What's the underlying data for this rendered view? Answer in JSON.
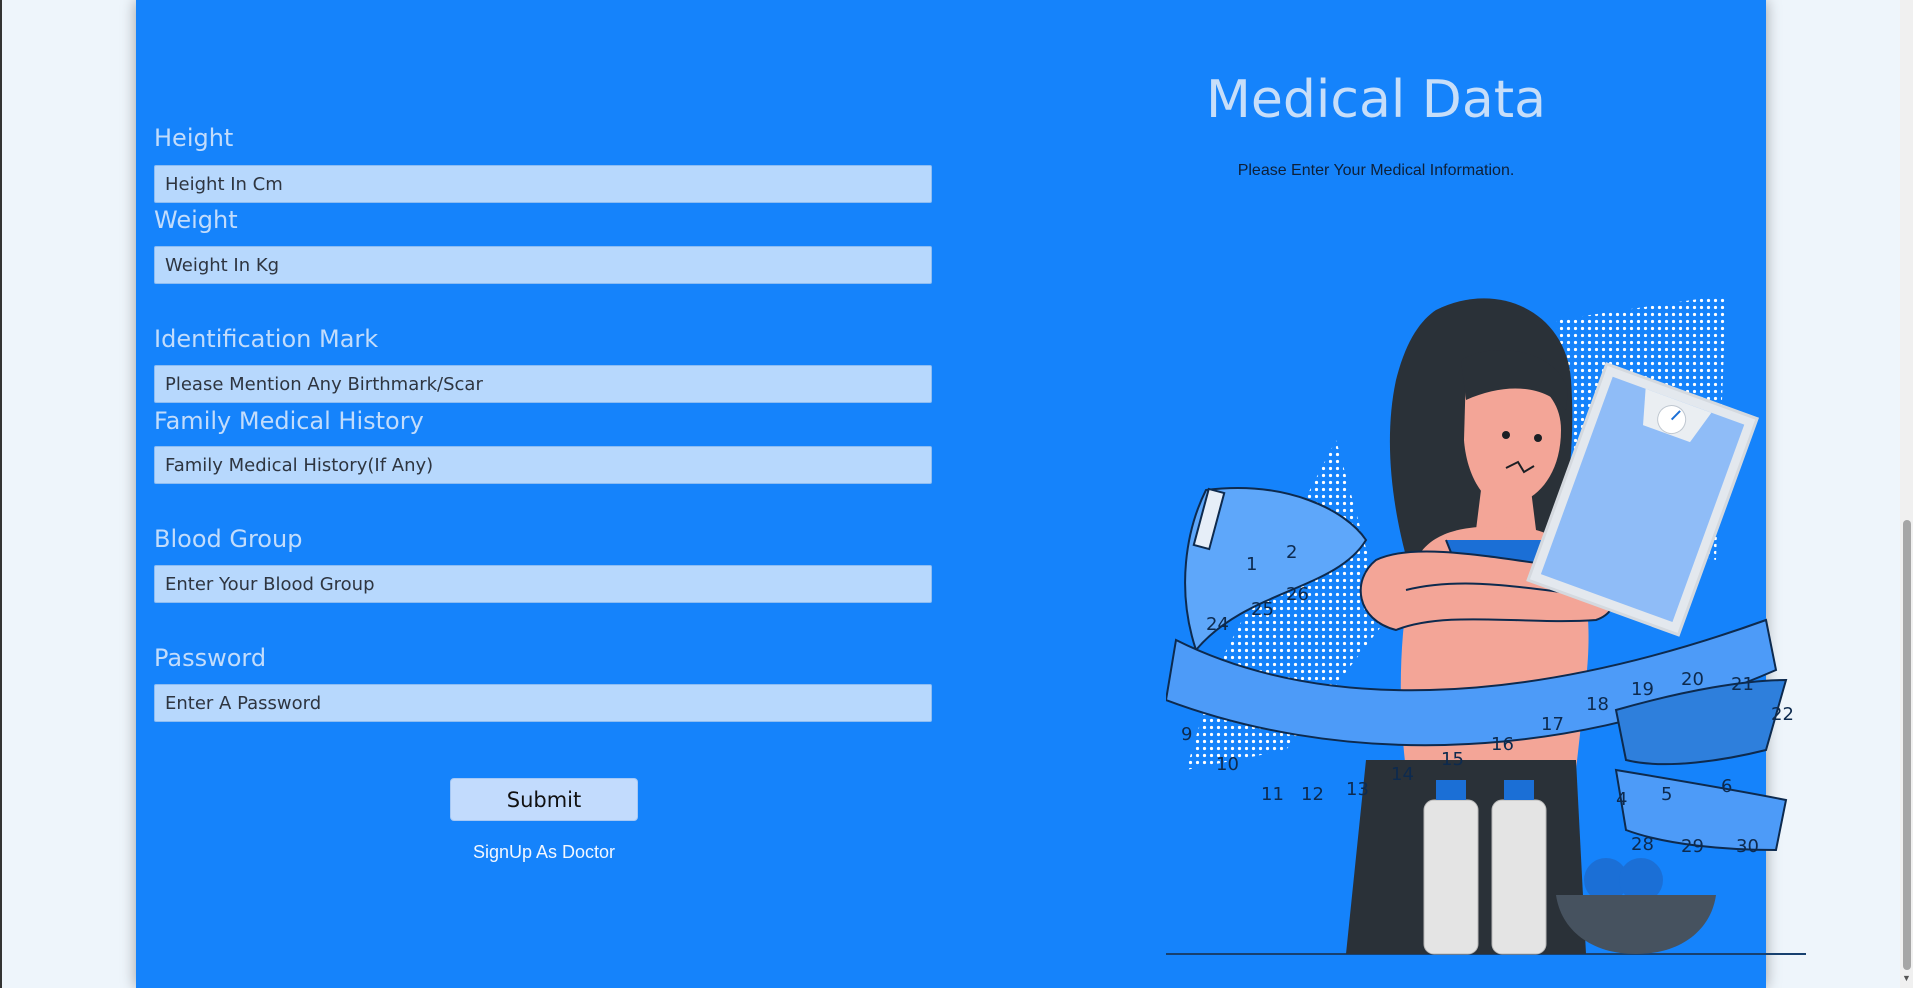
{
  "page": {
    "title": "Medical Data",
    "subtitle": "Please Enter Your Medical Information."
  },
  "form": {
    "fields": [
      {
        "label": "Height",
        "placeholder": "Height In Cm"
      },
      {
        "label": "Weight",
        "placeholder": "Weight In Kg"
      },
      {
        "label": "Identification Mark",
        "placeholder": "Please Mention Any Birthmark/Scar"
      },
      {
        "label": "Family Medical History",
        "placeholder": "Family Medical History(If Any)"
      },
      {
        "label": "Blood Group",
        "placeholder": "Enter Your Blood Group"
      },
      {
        "label": "Password",
        "placeholder": "Enter A Password"
      }
    ],
    "submit_label": "Submit",
    "signup_link": "SignUp As Doctor"
  },
  "illustration": {
    "icon": "woman-with-scale-and-measuring-tape-illustration",
    "scale_numbers": [
      "1",
      "2",
      "24",
      "25",
      "26",
      "9",
      "10",
      "11",
      "12",
      "13",
      "14",
      "15",
      "16",
      "17",
      "18",
      "19",
      "20",
      "21",
      "22",
      "4",
      "5",
      "6",
      "28",
      "29",
      "30"
    ]
  },
  "colors": {
    "card_background": "#1583fb",
    "input_background": "#b7d8fd",
    "label_color": "#c2dcfb",
    "button_background": "#c2dbfd"
  }
}
